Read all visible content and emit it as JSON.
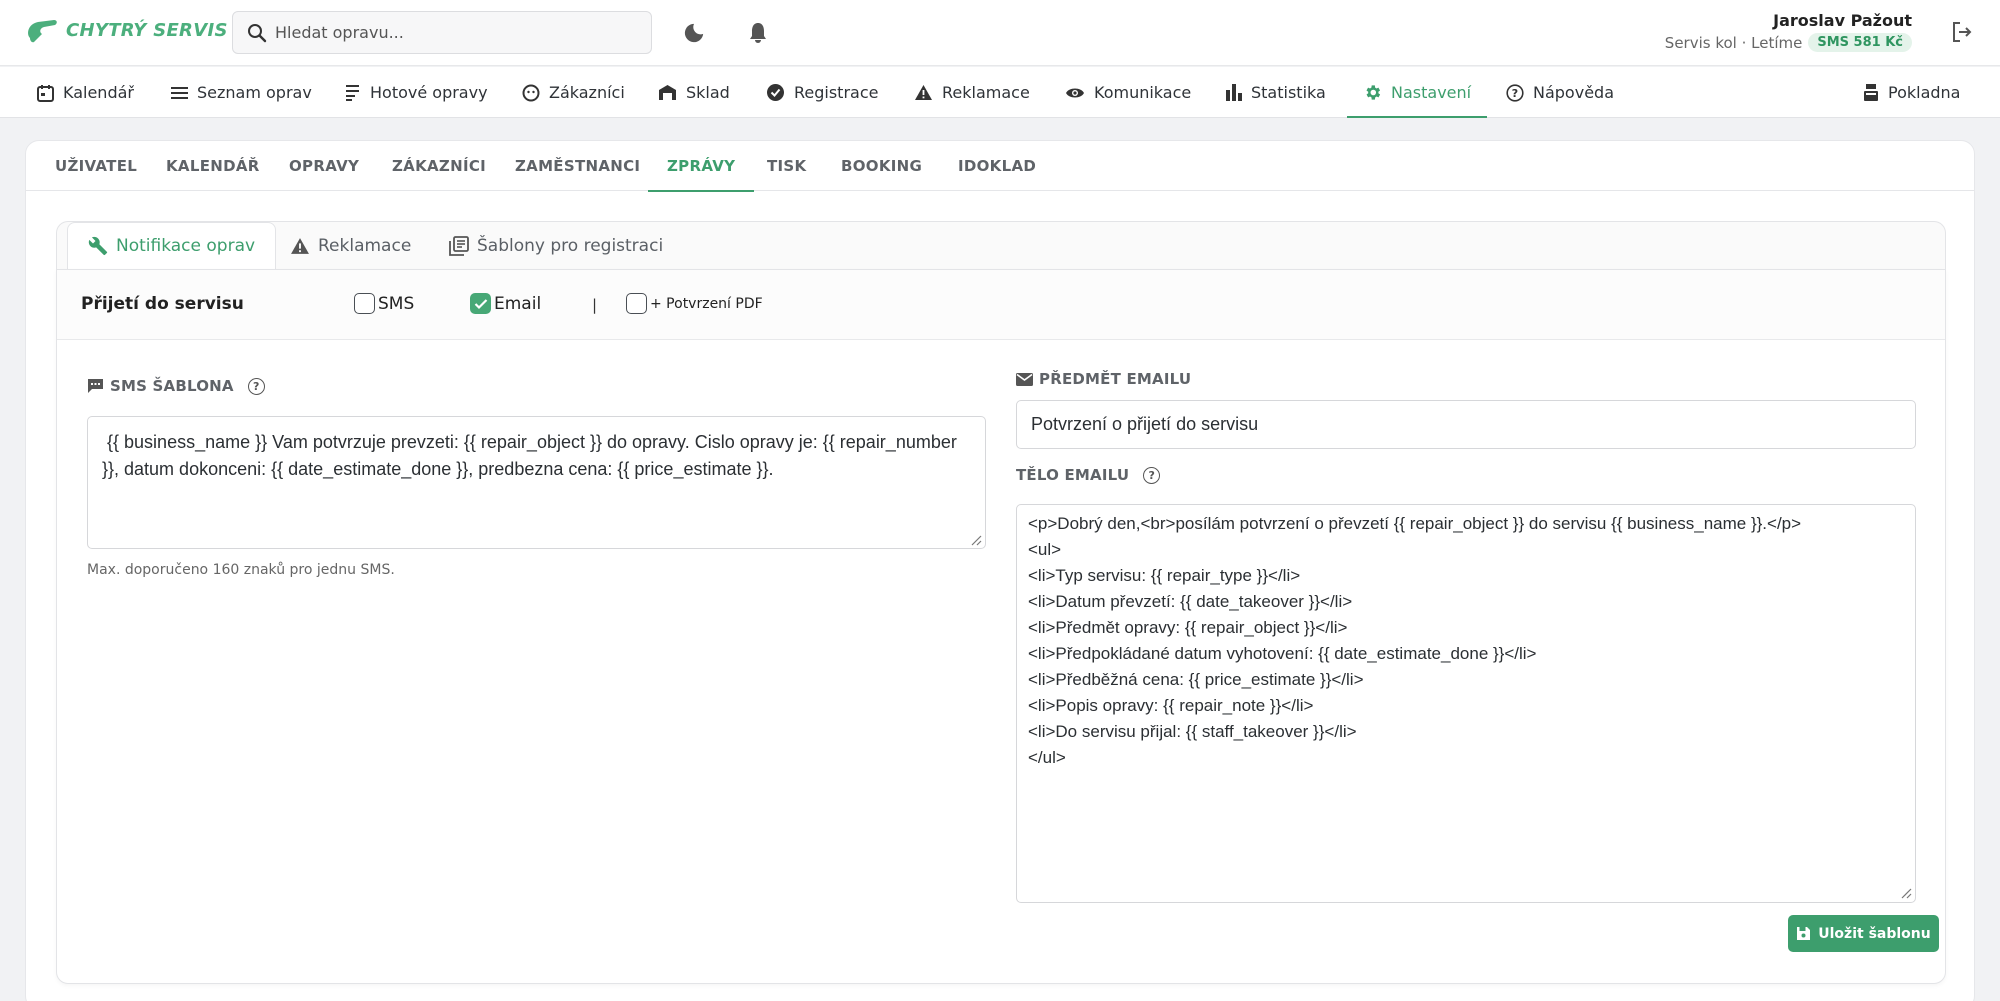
{
  "app": {
    "logo_text": "CHYTRÝ SERVIS",
    "brand_color": "#4caf7d",
    "accent_color": "#3d9e6d"
  },
  "header": {
    "search_placeholder": "Hledat opravu...",
    "user_name": "Jaroslav Pažout",
    "user_subtitle": "Servis kol · Letíme",
    "sms_balance": "SMS 581 Kč",
    "icons": [
      "moon-icon",
      "bell-icon",
      "logout-icon"
    ]
  },
  "nav": {
    "items": [
      {
        "label": "Kalendář",
        "icon": "calendar-icon"
      },
      {
        "label": "Seznam oprav",
        "icon": "list-icon"
      },
      {
        "label": "Hotové opravy",
        "icon": "checklist-icon"
      },
      {
        "label": "Zákazníci",
        "icon": "face-icon"
      },
      {
        "label": "Sklad",
        "icon": "warehouse-icon"
      },
      {
        "label": "Registrace",
        "icon": "verified-icon"
      },
      {
        "label": "Reklamace",
        "icon": "warning-icon"
      },
      {
        "label": "Komunikace",
        "icon": "eye-icon"
      },
      {
        "label": "Statistika",
        "icon": "bar-chart-icon"
      },
      {
        "label": "Nastavení",
        "icon": "gear-icon",
        "active": true
      },
      {
        "label": "Nápověda",
        "icon": "help-icon"
      }
    ],
    "right_item": {
      "label": "Pokladna",
      "icon": "cash-register-icon"
    }
  },
  "settings_tabs": {
    "items": [
      "UŽIVATEL",
      "KALENDÁŘ",
      "OPRAVY",
      "ZÁKAZNÍCI",
      "ZAMĚSTNANCI",
      "ZPRÁVY",
      "TISK",
      "BOOKING",
      "IDOKLAD"
    ],
    "active": "ZPRÁVY"
  },
  "message_tabs": {
    "items": [
      {
        "label": "Notifikace oprav",
        "icon": "wrench-icon",
        "active": true
      },
      {
        "label": "Reklamace",
        "icon": "warning-icon"
      },
      {
        "label": "Šablony pro registraci",
        "icon": "library-icon"
      }
    ]
  },
  "section": {
    "title": "Přijetí do servisu",
    "options": {
      "sms": {
        "label": "SMS",
        "checked": false
      },
      "email": {
        "label": "Email",
        "checked": true
      },
      "separator": "|",
      "pdf": {
        "label": "+ Potvrzení PDF",
        "checked": false
      }
    }
  },
  "sms": {
    "label": "SMS ŠABLONA",
    "template": " {{ business_name }} Vam potvrzuje prevzeti: {{ repair_object }} do opravy. Cislo opravy je: {{ repair_number }}, datum dokonceni: {{ date_estimate_done }}, predbezna cena: {{ price_estimate }}.",
    "hint": "Max. doporučeno 160 znaků pro jednu SMS."
  },
  "email": {
    "subject_label": "PŘEDMĚT EMAILU",
    "subject_value": "Potvrzení o přijetí do servisu",
    "body_label": "TĚLO EMAILU",
    "body_value": "<p>Dobrý den,<br>posílám potvrzení o převzetí {{ repair_object }} do servisu {{ business_name }}.</p>\n<ul>\n<li>Typ servisu: {{ repair_type }}</li>\n<li>Datum převzetí: {{ date_takeover }}</li>\n<li>Předmět opravy: {{ repair_object }}</li>\n<li>Předpokládané datum vyhotovení: {{ date_estimate_done }}</li>\n<li>Předběžná cena: {{ price_estimate }}</li>\n<li>Popis opravy: {{ repair_note }}</li>\n<li>Do servisu přijal: {{ staff_takeover }}</li>\n</ul>"
  },
  "actions": {
    "save_label": "Uložit šablonu"
  }
}
